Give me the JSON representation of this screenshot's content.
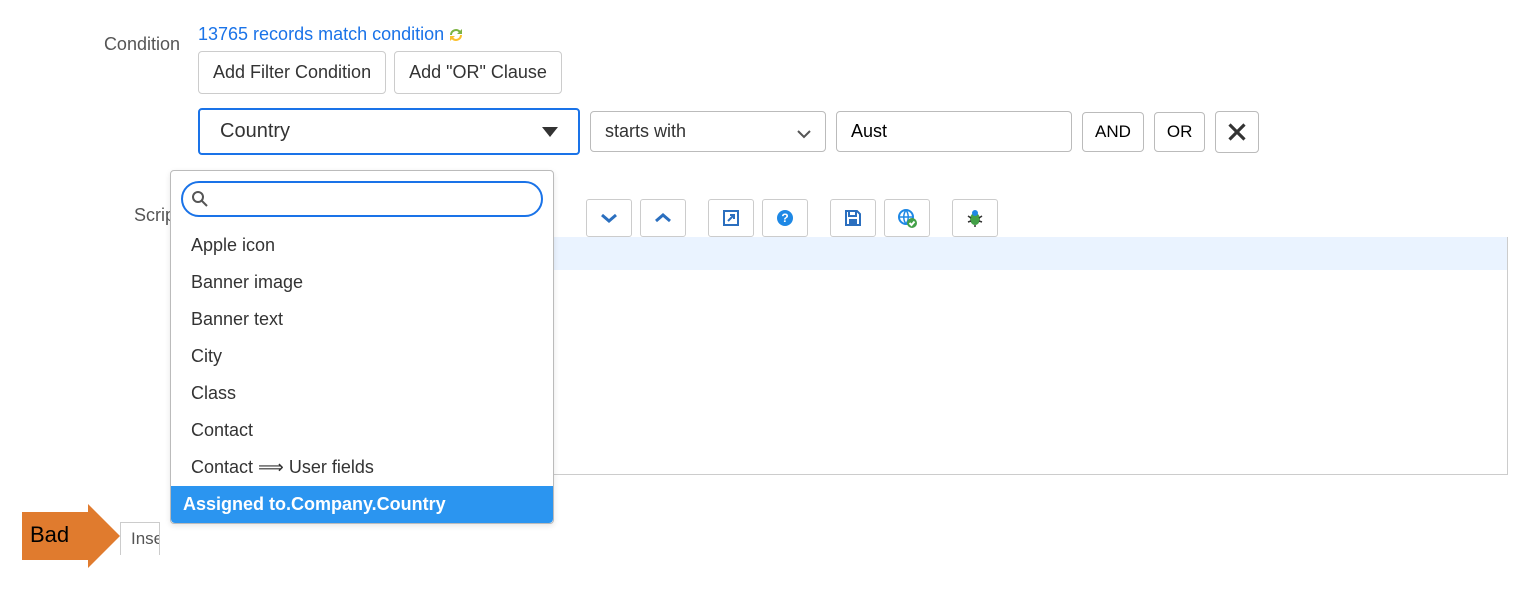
{
  "condition": {
    "label": "Condition",
    "match_text": "13765 records match condition",
    "buttons": {
      "add_filter": "Add Filter Condition",
      "add_or": "Add \"OR\" Clause"
    },
    "filter": {
      "field": "Country",
      "operator": "starts with",
      "value": "Aust",
      "and": "AND",
      "or": "OR"
    },
    "dropdown": {
      "search_placeholder": "",
      "options": [
        "Apple icon",
        "Banner image",
        "Banner text",
        "City",
        "Class",
        "Contact",
        "Contact ⟹ User fields"
      ],
      "path": "Assigned to.Company.Country"
    }
  },
  "script": {
    "label": "Script"
  },
  "annotation": {
    "bad": "Bad",
    "insert_partial": "Inse"
  }
}
